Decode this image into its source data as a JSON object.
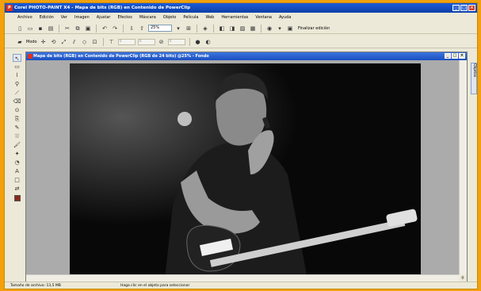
{
  "app": {
    "title": "Corel PHOTO-PAINT X4 - Mapa de bits (RGB) en Contenido de PowerClip",
    "icon_label": "P"
  },
  "menu": [
    "Archivo",
    "Edición",
    "Ver",
    "Imagen",
    "Ajustar",
    "Efectos",
    "Máscara",
    "Objeto",
    "Película",
    "Web",
    "Herramientas",
    "Ventana",
    "Ayuda"
  ],
  "toolbar": {
    "zoom_value": "25%",
    "finalizar_label": "Finalizar edición",
    "modo_label": "Modo",
    "mini_field_value": "0"
  },
  "document": {
    "title": "Mapa de bits (RGB) en Contenido de PowerClip (RGB de 24 bits) @25% - Fondo"
  },
  "dockers": {
    "tab_label": "Objetos"
  },
  "status": {
    "file_size": "Tamaño de archivo: 13,5 MB",
    "hint": "Haga clic en el objeto para seleccionar"
  },
  "colors": {
    "foreground": "#8a2a1a",
    "palette": [
      "#f0e0c8",
      "#e8d0a8",
      "#d8b888",
      "#c89868",
      "#e8c8b0",
      "#d8a888",
      "#c88868",
      "#b87050",
      "#f0d8d0",
      "#e0b8a8",
      "#d09880",
      "#c07860",
      "#f8e8d8",
      "#e8c898",
      "#d8a870",
      "#b88850",
      "#f0c8a0",
      "#d8a070",
      "#c08050",
      "#a86838",
      "#e8b8a0",
      "#d09878",
      "#b87858",
      "#a06040",
      "#f8d8c0",
      "#e0b890",
      "#c89868",
      "#b07848"
    ]
  }
}
